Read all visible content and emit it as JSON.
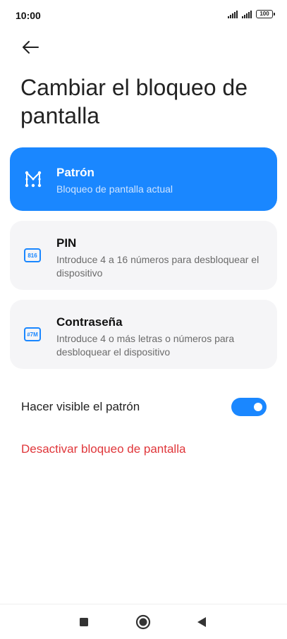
{
  "status_bar": {
    "time": "10:00",
    "battery": "100"
  },
  "header": {
    "back_icon": "arrow-left-icon",
    "title": "Cambiar el bloqueo de pantalla"
  },
  "options": [
    {
      "title": "Patrón",
      "description": "Bloqueo de pantalla actual",
      "icon": "pattern-icon",
      "selected": true
    },
    {
      "title": "PIN",
      "description": "Introduce 4 a 16 números para desbloquear el dispositivo",
      "icon": "pin-icon",
      "icon_text": "816",
      "selected": false
    },
    {
      "title": "Contraseña",
      "description": "Introduce 4 o más letras o números para desbloquear el dispositivo",
      "icon": "password-icon",
      "icon_text": "#7M",
      "selected": false
    }
  ],
  "settings": {
    "visible_pattern_label": "Hacer visible el patrón",
    "visible_pattern_on": true,
    "disable_lock_label": "Desactivar bloqueo de pantalla"
  },
  "colors": {
    "accent": "#1a87ff",
    "danger": "#e0363a",
    "card_bg": "#f5f5f7"
  },
  "nav_bar": {
    "recent_icon": "square-icon",
    "home_icon": "circle-icon",
    "back_icon": "triangle-back-icon"
  }
}
